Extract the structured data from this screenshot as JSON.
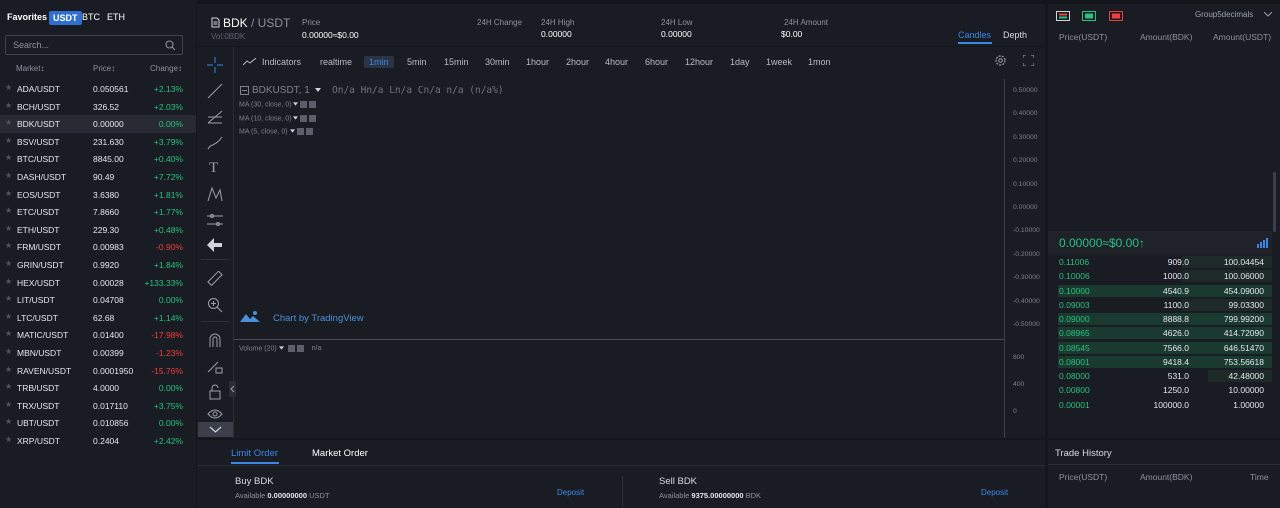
{
  "colors": {
    "up": "#27c27d",
    "down": "#ee3e3e",
    "accent": "#3b87e8",
    "bg": "#14161c",
    "panel": "#1a1c23"
  },
  "market_tabs": [
    {
      "label": "Favorites",
      "active": false
    },
    {
      "label": "USDT",
      "active": true
    },
    {
      "label": "BTC",
      "active": false
    },
    {
      "label": "ETH",
      "active": false
    }
  ],
  "search": {
    "placeholder": "Search..."
  },
  "market_columns": {
    "market": "Market↕",
    "price": "Price↕",
    "change": "Change↕"
  },
  "markets": [
    {
      "pair": "ADA/USDT",
      "price": "0.050561",
      "change": "+2.13%",
      "dir": "up"
    },
    {
      "pair": "BCH/USDT",
      "price": "326.52",
      "change": "+2.03%",
      "dir": "up"
    },
    {
      "pair": "BDK/USDT",
      "price": "0.00000",
      "change": "0.00%",
      "dir": "up",
      "selected": true
    },
    {
      "pair": "BSV/USDT",
      "price": "231.630",
      "change": "+3.79%",
      "dir": "up"
    },
    {
      "pair": "BTC/USDT",
      "price": "8845.00",
      "change": "+0.40%",
      "dir": "up"
    },
    {
      "pair": "DASH/USDT",
      "price": "90.49",
      "change": "+7.72%",
      "dir": "up"
    },
    {
      "pair": "EOS/USDT",
      "price": "3.6380",
      "change": "+1.81%",
      "dir": "up"
    },
    {
      "pair": "ETC/USDT",
      "price": "7.8660",
      "change": "+1.77%",
      "dir": "up"
    },
    {
      "pair": "ETH/USDT",
      "price": "229.30",
      "change": "+0.48%",
      "dir": "up"
    },
    {
      "pair": "FRM/USDT",
      "price": "0.00983",
      "change": "-0.90%",
      "dir": "down"
    },
    {
      "pair": "GRIN/USDT",
      "price": "0.9920",
      "change": "+1.84%",
      "dir": "up"
    },
    {
      "pair": "HEX/USDT",
      "price": "0.00028",
      "change": "+133.33%",
      "dir": "up"
    },
    {
      "pair": "LIT/USDT",
      "price": "0.04708",
      "change": "0.00%",
      "dir": "up"
    },
    {
      "pair": "LTC/USDT",
      "price": "62.68",
      "change": "+1.14%",
      "dir": "up"
    },
    {
      "pair": "MATIC/USDT",
      "price": "0.01400",
      "change": "-17.98%",
      "dir": "down"
    },
    {
      "pair": "MBN/USDT",
      "price": "0.00399",
      "change": "-1.23%",
      "dir": "down"
    },
    {
      "pair": "RAVEN/USDT",
      "price": "0.0001950",
      "change": "-15.76%",
      "dir": "down"
    },
    {
      "pair": "TRB/USDT",
      "price": "4.0000",
      "change": "0.00%",
      "dir": "up"
    },
    {
      "pair": "TRX/USDT",
      "price": "0.017110",
      "change": "+3.75%",
      "dir": "up"
    },
    {
      "pair": "UBT/USDT",
      "price": "0.010856",
      "change": "0.00%",
      "dir": "up"
    },
    {
      "pair": "XRP/USDT",
      "price": "0.2404",
      "change": "+2.42%",
      "dir": "up"
    }
  ],
  "header": {
    "base": "BDK",
    "quote": "/ USDT",
    "vol": "Vol:0BDK",
    "price_label": "Price",
    "price_value": "0.00000≈$0.00",
    "change_label": "24H Change",
    "high_label": "24H High",
    "high_value": "0.00000",
    "low_label": "24H Low",
    "low_value": "0.00000",
    "amount_label": "24H Amount",
    "amount_value": "$0.00",
    "view_tabs": [
      "Candles",
      "Depth"
    ]
  },
  "toolbar": {
    "indicators": "Indicators",
    "intervals": [
      "realtime",
      "1min",
      "5min",
      "15min",
      "30min",
      "1hour",
      "2hour",
      "4hour",
      "6hour",
      "12hour",
      "1day",
      "1week",
      "1mon"
    ],
    "active_interval": "1min"
  },
  "chart": {
    "symbol_legend": "BDKUSDT, 1",
    "ohlc_legend": "On/a  Hn/a  Ln/a  Cn/a  n/a (n/a%)",
    "ma_lines": [
      "MA (30, close, 0)",
      "MA (10, close, 0)",
      "MA (5, close, 0)"
    ],
    "price_ticks": [
      "0.50000",
      "0.40000",
      "0.30000",
      "0.20000",
      "0.10000",
      "0.00000",
      "-0.10000",
      "-0.20000",
      "-0.30000",
      "-0.40000",
      "-0.50000"
    ],
    "volume_legend": "Volume (20)",
    "volume_value": "n/a",
    "volume_ticks": [
      "800",
      "400",
      "0"
    ],
    "watermark": "Chart by TradingView"
  },
  "order": {
    "tabs": [
      "Limit Order",
      "Market Order"
    ],
    "active_tab": "Limit Order",
    "buy_title": "Buy BDK",
    "buy_available_label": "Available",
    "buy_available_value": "0.00000000",
    "buy_unit": "USDT",
    "sell_title": "Sell BDK",
    "sell_available_label": "Available",
    "sell_available_value": "9375.00000000",
    "sell_unit": "BDK",
    "deposit": "Deposit"
  },
  "orderbook": {
    "group_label": "Group5decimals",
    "columns": [
      "Price(USDT)",
      "Amount(BDK)",
      "Amount(USDT)"
    ],
    "last_price": "0.00000≈$0.00↑",
    "bids": [
      {
        "price": "0.11006",
        "amount": "909.0",
        "total": "100.04454",
        "depth": 0.42
      },
      {
        "price": "0.10006",
        "amount": "1000.0",
        "total": "100.06000",
        "depth": 0.42
      },
      {
        "price": "0.10000",
        "amount": "4540.9",
        "total": "454.09000",
        "depth": 1.0
      },
      {
        "price": "0.09003",
        "amount": "1100.0",
        "total": "99.03300",
        "depth": 0.42
      },
      {
        "price": "0.09000",
        "amount": "8888.8",
        "total": "799.99200",
        "depth": 1.0
      },
      {
        "price": "0.08965",
        "amount": "4626.0",
        "total": "414.72090",
        "depth": 1.0
      },
      {
        "price": "0.08545",
        "amount": "7566.0",
        "total": "646.51470",
        "depth": 1.0
      },
      {
        "price": "0.08001",
        "amount": "9418.4",
        "total": "753.56618",
        "depth": 1.0
      },
      {
        "price": "0.08000",
        "amount": "531.0",
        "total": "42.48000",
        "depth": 0.3
      },
      {
        "price": "0.00800",
        "amount": "1250.0",
        "total": "10.00000",
        "depth": 0
      },
      {
        "price": "0.00001",
        "amount": "100000.0",
        "total": "1.00000",
        "depth": 0
      }
    ]
  },
  "trade_history": {
    "title": "Trade History",
    "columns": [
      "Price(USDT)",
      "Amount(BDK)",
      "Time"
    ]
  }
}
